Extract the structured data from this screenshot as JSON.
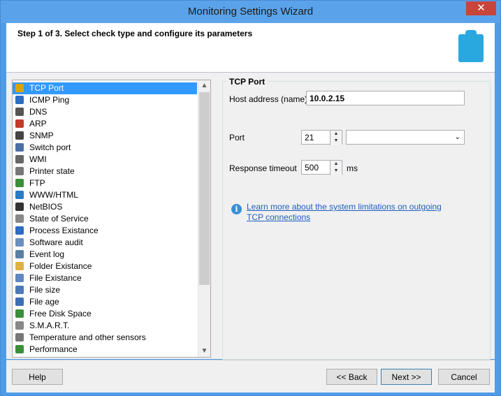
{
  "window": {
    "title": "Monitoring Settings Wizard",
    "close_glyph": "✕"
  },
  "header": {
    "step": "Step 1 of 3. Select check type and configure its parameters",
    "icon": "clipboard-icon"
  },
  "check_types": [
    {
      "label": "TCP Port",
      "icon": "tcp-port-icon",
      "selected": true
    },
    {
      "label": "ICMP Ping",
      "icon": "icmp-ping-icon"
    },
    {
      "label": "DNS",
      "icon": "dns-icon"
    },
    {
      "label": "ARP",
      "icon": "arp-icon"
    },
    {
      "label": "SNMP",
      "icon": "snmp-icon"
    },
    {
      "label": "Switch port",
      "icon": "switch-port-icon"
    },
    {
      "label": "WMI",
      "icon": "wmi-icon"
    },
    {
      "label": "Printer state",
      "icon": "printer-icon"
    },
    {
      "label": "FTP",
      "icon": "ftp-icon"
    },
    {
      "label": "WWW/HTML",
      "icon": "globe-icon"
    },
    {
      "label": "NetBIOS",
      "icon": "netbios-icon"
    },
    {
      "label": "State of Service",
      "icon": "gear-icon"
    },
    {
      "label": "Process Existance",
      "icon": "process-icon"
    },
    {
      "label": "Software audit",
      "icon": "software-audit-icon"
    },
    {
      "label": "Event log",
      "icon": "event-log-icon"
    },
    {
      "label": "Folder Existance",
      "icon": "folder-icon"
    },
    {
      "label": "File Existance",
      "icon": "file-icon"
    },
    {
      "label": "File size",
      "icon": "file-size-icon"
    },
    {
      "label": "File age",
      "icon": "calendar-icon"
    },
    {
      "label": "Free Disk Space",
      "icon": "disk-icon"
    },
    {
      "label": "S.M.A.R.T.",
      "icon": "hard-drive-icon"
    },
    {
      "label": "Temperature and other sensors",
      "icon": "sensor-icon"
    },
    {
      "label": "Performance",
      "icon": "chip-icon"
    }
  ],
  "panel": {
    "group_title": "TCP Port",
    "host_label": "Host address (name)",
    "host_value": "10.0.2.15",
    "port_label": "Port",
    "port_value": "21",
    "port_service_value": "",
    "timeout_label": "Response timeout",
    "timeout_value": "500",
    "timeout_unit": "ms",
    "info_link": "Learn more about the system limitations on outgoing TCP connections"
  },
  "footer": {
    "help": "Help",
    "back": "<< Back",
    "next": "Next >>",
    "cancel": "Cancel"
  },
  "colors": {
    "titlebar": "#5aa3ea",
    "selection": "#3399ff",
    "link": "#1d5fbf",
    "close": "#c7453b"
  }
}
